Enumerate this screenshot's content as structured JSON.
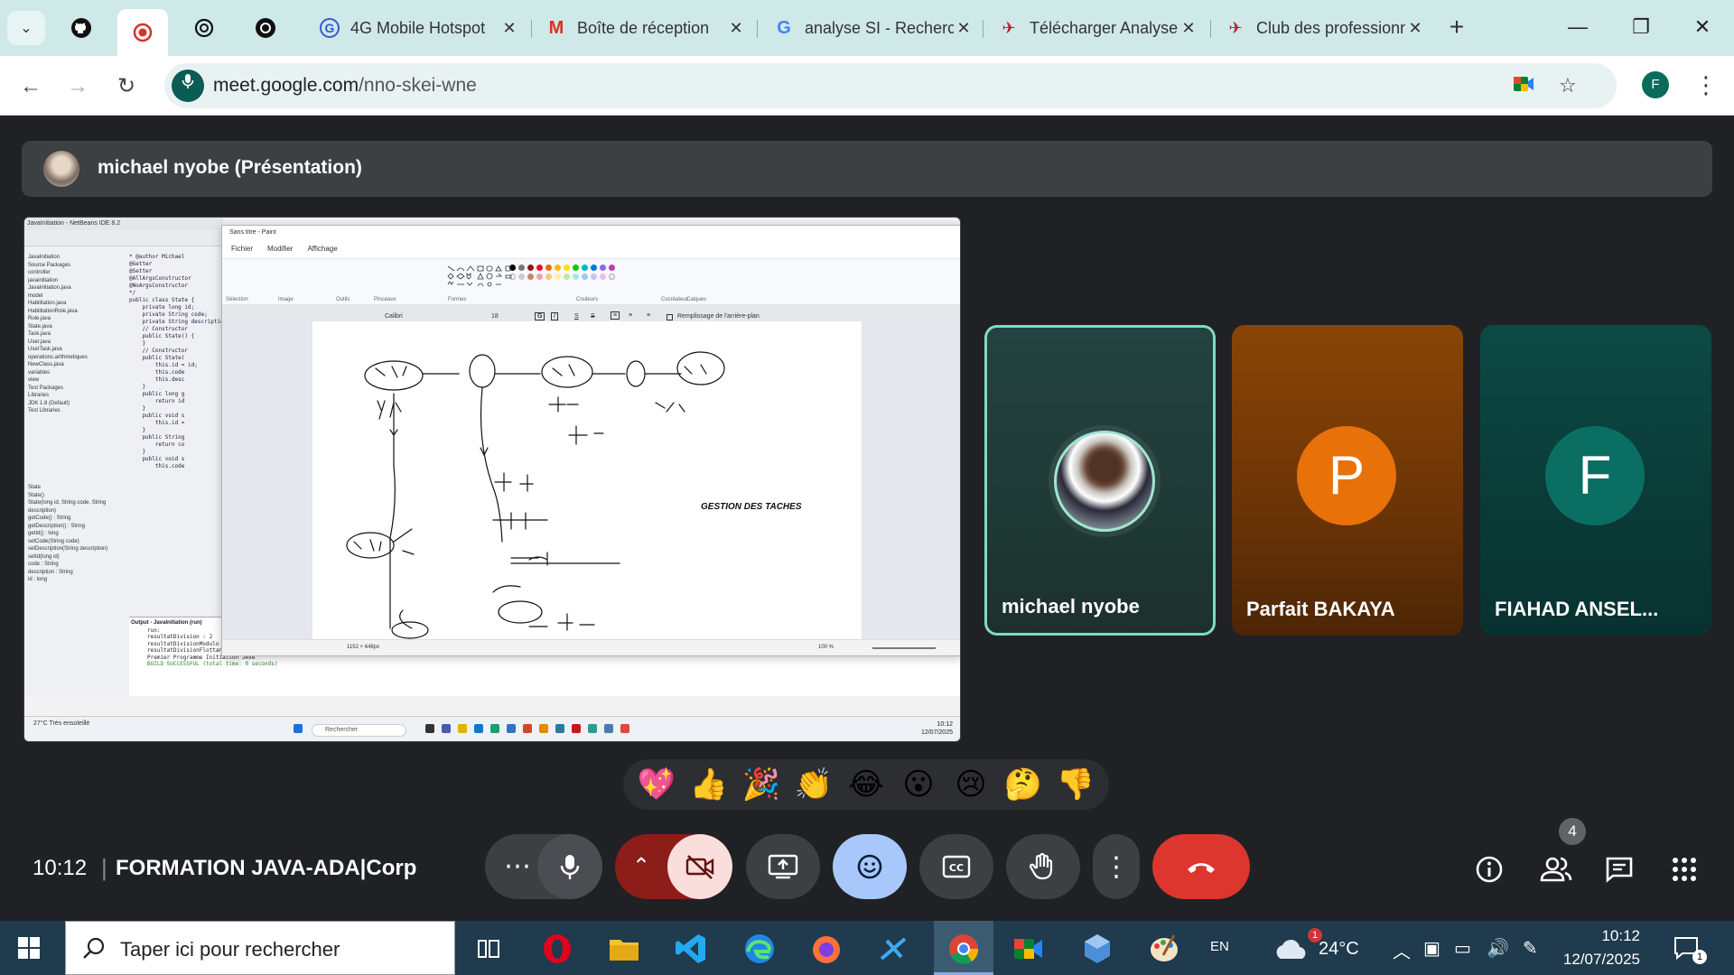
{
  "browser": {
    "tabs": [
      {
        "title": "4G Mobile Hotspot",
        "icon": "hotspot-icon"
      },
      {
        "title": "Boîte de réception",
        "icon": "gmail-icon"
      },
      {
        "title": "analyse SI - Recherche",
        "icon": "google-icon"
      },
      {
        "title": "Télécharger Analyse",
        "icon": "download-site-icon"
      },
      {
        "title": "Club des professionnels",
        "icon": "club-site-icon"
      }
    ],
    "url_host": "meet.google.com",
    "url_path": "/nno-skei-wne",
    "profile_initial": "F"
  },
  "meet": {
    "presenter_bar": "michael nyobe (Présentation)",
    "participants": [
      {
        "name": "michael nyobe",
        "initial": "",
        "color": "#234240",
        "active_speaker": true
      },
      {
        "name": "Parfait BAKAYA",
        "initial": "P",
        "color": "#e8710a"
      },
      {
        "name": "FIAHAD ANSEL...",
        "initial": "F",
        "color": "#0b6e63"
      }
    ],
    "reactions": [
      "💖",
      "👍",
      "🎉",
      "👏",
      "😂",
      "😮",
      "😢",
      "🤔",
      "👎"
    ],
    "time": "10:12",
    "meeting_title": "FORMATION JAVA-ADA|Corp",
    "participant_count": "4"
  },
  "shared_screen": {
    "paint_title": "Sans titre - Paint",
    "paint_menu": [
      "Fichier",
      "Modifier",
      "Affichage"
    ],
    "paint_groups": [
      "Sélection",
      "Image",
      "Outils",
      "Pinceaux",
      "Formes",
      "Couleurs",
      "Cocréateur",
      "Calques"
    ],
    "font_name": "Calibri",
    "font_size": "18",
    "bg_fill_label": "Remplissage de l'arrière-plan",
    "canvas_note": "GESTION DES TACHES",
    "canvas_size": "1152 × 648px",
    "zoom": "100 %",
    "nb_title": "JavaInitiation - NetBeans IDE 8.2",
    "nb_tree": [
      "JavaInitiation",
      "Source Packages",
      "controller",
      "javainitiation",
      "JavaInitiation.java",
      "model",
      "Habilitation.java",
      "HabilitationRole.java",
      "Role.java",
      "State.java",
      "Task.java",
      "User.java",
      "UserTask.java",
      "operations.arithmetiques",
      "NewClass.java",
      "variables",
      "view",
      "Test Packages",
      "Libraries",
      "JDK 1.8 (Default)",
      "Test Libraries"
    ],
    "nb_navigator": [
      "State",
      "State()",
      "State(long id, String code, String description)",
      "getCode() : String",
      "getDescription() : String",
      "getId() : long",
      "setCode(String code)",
      "setDescription(String description)",
      "setId(long id)",
      "code : String",
      "description : String",
      "id : long"
    ],
    "nb_code": [
      "* @author Michael",
      "@Getter",
      "@Setter",
      "@AllArgsConstructor",
      "@NoArgsConstructor",
      "*/",
      "public class State {",
      "    private long id;",
      "    private String code;",
      "    private String description;",
      "",
      "    // Constructor",
      "    public State() {",
      "    }",
      "",
      "    // Constructor",
      "    public State(",
      "        this.id = id;",
      "        this.code",
      "        this.desc",
      "    }",
      "",
      "    public long g",
      "        return id",
      "    }",
      "",
      "    public void s",
      "        this.id =",
      "    }",
      "",
      "    public String",
      "        return co",
      "    }",
      "",
      "    public void s",
      "        this.code"
    ],
    "nb_output_header": "Output - JavaInitiation (run)",
    "nb_output": [
      "run:",
      "resultatDivision : 2",
      "resultatDivisionModulo : 1",
      "resultatDivisionFlottant : 2.5",
      "Premier Programme Initiation JAVA",
      "BUILD SUCCESSFUL (total time: 0 seconds)"
    ],
    "mini_search": "Rechercher",
    "mini_weather": "27°C Très ensoleillé",
    "mini_time": "10:12",
    "mini_date": "12/07/2025"
  },
  "taskbar": {
    "search_placeholder": "Taper ici pour rechercher",
    "lang": "EN",
    "temp": "24°C",
    "weather_badge": "1",
    "time": "10:12",
    "date": "12/07/2025",
    "notif_count": "1"
  }
}
